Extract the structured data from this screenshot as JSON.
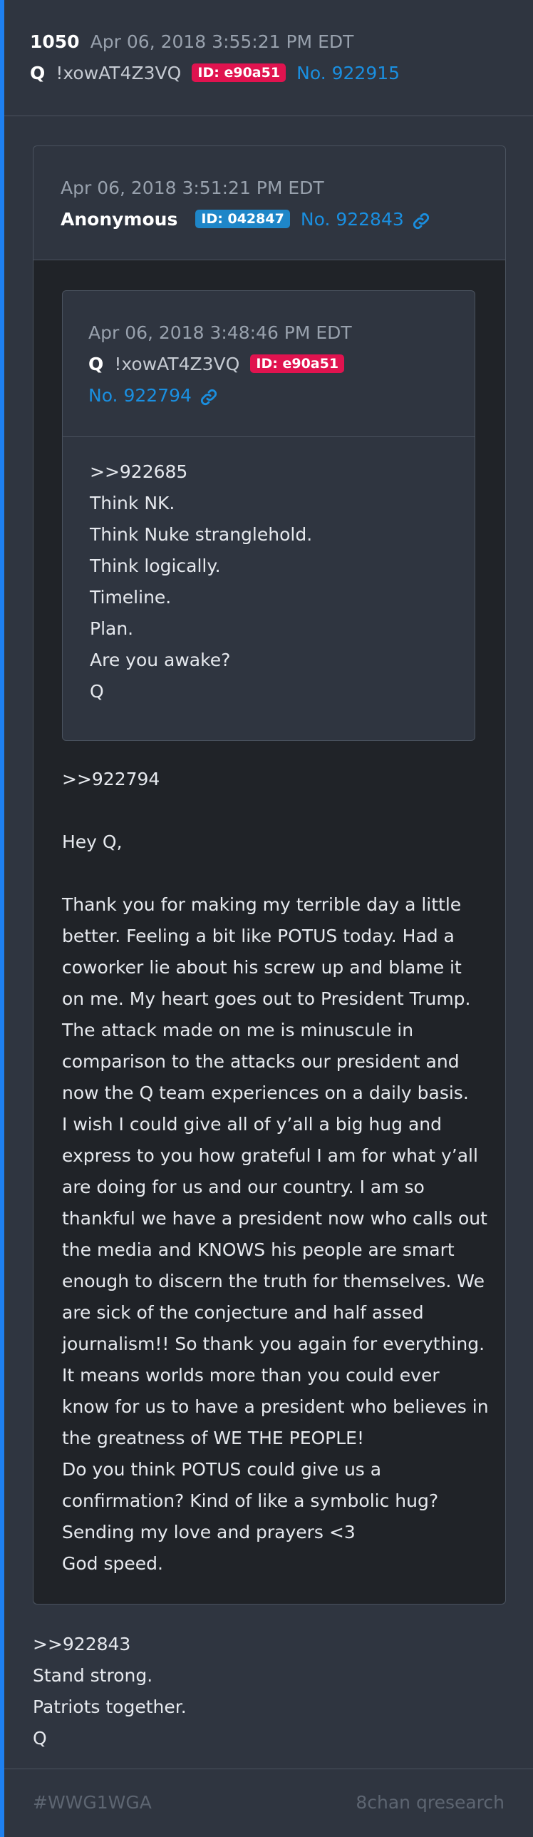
{
  "post": {
    "number": "1050",
    "date": "Apr 06, 2018 3:55:21 PM EDT",
    "author": "Q",
    "tripcode": "!xowAT4Z3VQ",
    "id_badge": "ID: e90a51",
    "post_no": "No. 922915"
  },
  "quoted": {
    "date": "Apr 06, 2018 3:51:21 PM EDT",
    "author": "Anonymous",
    "id_badge": "ID: 042847",
    "post_no": "No. 922843",
    "nested": {
      "date": "Apr 06, 2018 3:48:46 PM EDT",
      "author": "Q",
      "tripcode": "!xowAT4Z3VQ",
      "id_badge": "ID: e90a51",
      "post_no": "No. 922794",
      "lines": [
        ">>922685",
        "Think NK.",
        "Think Nuke stranglehold.",
        "Think logically.",
        "Timeline.",
        "Plan.",
        "Are you awake?",
        "Q"
      ]
    },
    "lines": [
      ">>922794",
      "",
      "Hey Q,",
      "",
      "Thank you for making my terrible day a little",
      "better. Feeling a bit like POTUS today. Had a",
      "coworker lie about his screw up and blame it",
      "on me. My heart goes out to President Trump.",
      "The attack made on me is minuscule in",
      "comparison to the attacks our president and",
      "now the Q team experiences on a daily basis.",
      "I wish I could give all of y’all a big hug and",
      "express to you how grateful I am for what y’all",
      "are doing for us and our country. I am so",
      "thankful we have a president now who calls out",
      "the media and KNOWS his people are smart",
      "enough to discern the truth for themselves. We",
      "are sick of the conjecture and half assed",
      "journalism!! So thank you again for everything.",
      "It means worlds more than you could ever",
      "know for us to have a president who believes in",
      "the greatness of WE THE PEOPLE!",
      "Do you think POTUS could give us a",
      "confirmation? Kind of like a symbolic hug?",
      "Sending my love and prayers <3",
      "God speed."
    ]
  },
  "reply_lines": [
    ">>922843",
    "Stand strong.",
    "Patriots together.",
    "Q"
  ],
  "footer": {
    "hashtag": "#WWG1WGA",
    "source": "8chan qresearch"
  },
  "colors": {
    "accent_bar": "#1e80f0",
    "link": "#1a8fe0",
    "id_red": "#e0134f",
    "id_blue": "#1e86c8"
  },
  "icons": {
    "link": "link-icon"
  }
}
